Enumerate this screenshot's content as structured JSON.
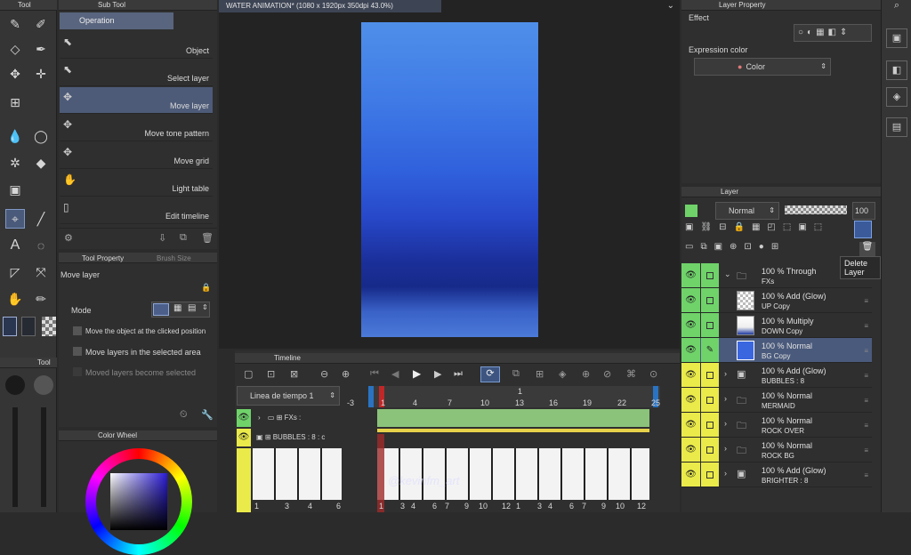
{
  "toolbar": {
    "title": "Tool"
  },
  "subtool": {
    "title": "Sub Tool",
    "group": "Operation",
    "items": [
      {
        "label": "Object"
      },
      {
        "label": "Select layer"
      },
      {
        "label": "Move layer"
      },
      {
        "label": "Move tone pattern"
      },
      {
        "label": "Move grid"
      },
      {
        "label": "Light table"
      },
      {
        "label": "Edit timeline"
      }
    ]
  },
  "toolprop": {
    "tab1": "Tool Property",
    "tab2": "Brush Size",
    "name": "Move layer",
    "mode_label": "Mode",
    "opt1": "Move the object at the clicked position",
    "opt2": "Move layers in the selected area",
    "opt3": "Moved layers become selected"
  },
  "toolbar2": {
    "title": "Tool"
  },
  "colorwheel": {
    "title": "Color Wheel"
  },
  "canvas": {
    "title": "WATER ANIMATION* (1080 x 1920px 350dpi 43.0%)",
    "watermark": "@kevinfm_art"
  },
  "timeline": {
    "title": "Timeline",
    "track_name": "Linea de tiempo 1",
    "ruler": [
      "-3",
      "1",
      "4",
      "7",
      "10",
      "13",
      "16",
      "19",
      "22",
      "25"
    ],
    "ruler_top_13": "1",
    "tracks": [
      {
        "label": "FXs :"
      },
      {
        "label": "BUBBLES : 8 : c"
      }
    ],
    "frame_labels": [
      "1",
      "3",
      "4",
      "6"
    ],
    "frame_labels_right": [
      "1",
      "3",
      "4",
      "6",
      "7",
      "9",
      "10",
      "12",
      "1",
      "3",
      "4",
      "6",
      "7",
      "9",
      "10",
      "12"
    ]
  },
  "layerprop": {
    "title": "Layer Property",
    "effect_label": "Effect",
    "expr_label": "Expression color",
    "expr_value": "Color"
  },
  "layers": {
    "title": "Layer",
    "blend": "Normal",
    "opacity": "100",
    "tooltip": "Delete Layer",
    "rows": [
      {
        "pct": "100 %  Through",
        "name": "FXs",
        "kind": "folder",
        "eye": "#6fd36a"
      },
      {
        "pct": "100 %  Add (Glow)",
        "name": "UP Copy",
        "kind": "thumb",
        "eye": "#6fd36a"
      },
      {
        "pct": "100 %  Multiply",
        "name": "DOWN Copy",
        "kind": "thumb",
        "eye": "#6fd36a"
      },
      {
        "pct": "100 %  Normal",
        "name": "BG Copy",
        "kind": "thumb",
        "eye": "#6fd36a"
      },
      {
        "pct": "100 %  Add (Glow)",
        "name": "BUBBLES : 8",
        "kind": "anim",
        "eye": "#eaea4a"
      },
      {
        "pct": "100 %  Normal",
        "name": "MERMAID",
        "kind": "folder",
        "eye": "#eaea4a"
      },
      {
        "pct": "100 %  Normal",
        "name": "ROCK OVER",
        "kind": "folder",
        "eye": "#eaea4a"
      },
      {
        "pct": "100 %  Normal",
        "name": "ROCK BG",
        "kind": "folder",
        "eye": "#eaea4a"
      },
      {
        "pct": "100 %  Add (Glow)",
        "name": "BRIGHTER : 8",
        "kind": "anim",
        "eye": "#eaea4a"
      }
    ]
  }
}
